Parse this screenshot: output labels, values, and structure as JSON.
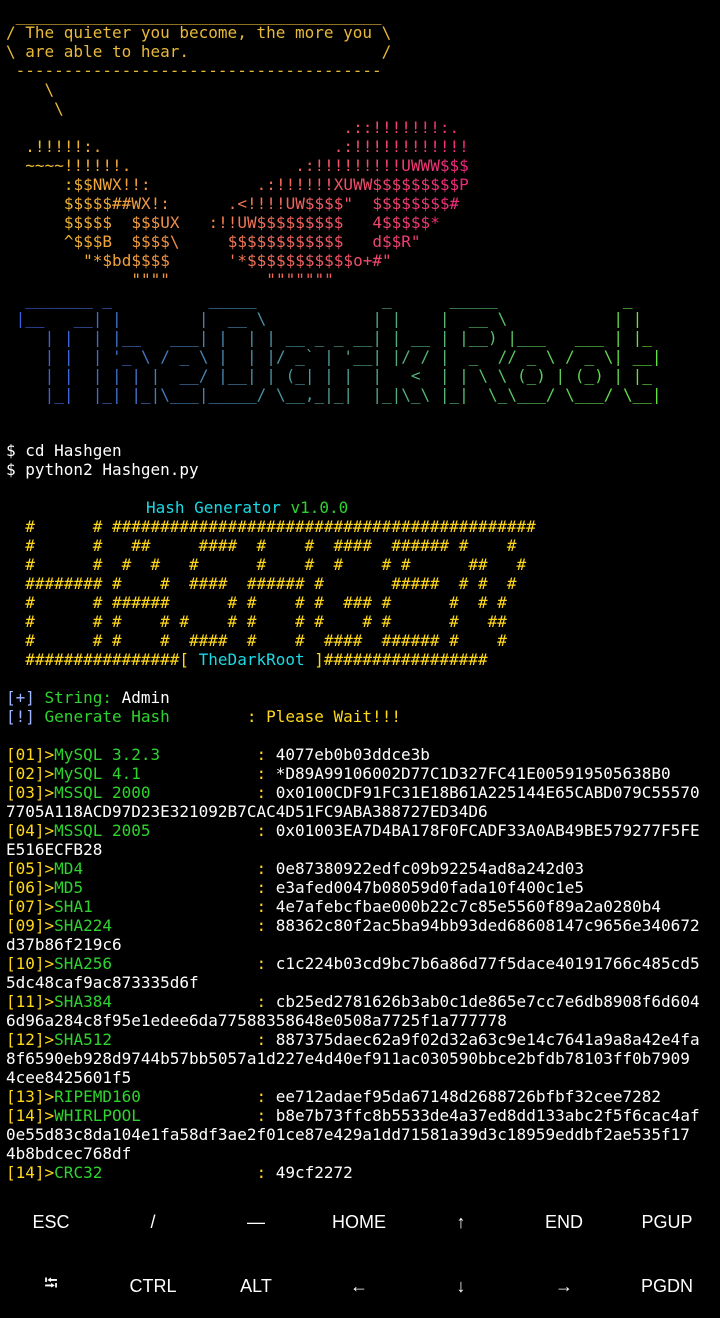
{
  "cowsay": {
    "lines": [
      " ______________________________________",
      "/ The quieter you become, the more you \\",
      "\\ are able to hear.                    /",
      " --------------------------------------",
      "    \\",
      "     \\"
    ]
  },
  "dragon_art": [
    "                                   .::!!!!!!!:.",
    "  .!!!!!:.                        .:!!!!!!!!!!!!",
    "  ~~~~!!!!!!.                 .:!!!!!!!!!UWWW$$$",
    "      :$$NWX!!:           .:!!!!!!XUWW$$$$$$$$$P",
    "      $$$$$##WX!:      .<!!!!UW$$$$\"  $$$$$$$$#",
    "      $$$$$  $$$UX   :!!UW$$$$$$$$$   4$$$$$*",
    "      ^$$$B  $$$$\\     $$$$$$$$$$$$   d$$R\"",
    "        \"*$bd$$$$      '*$$$$$$$$$$$o+#\"",
    "             \"\"\"\"          \"\"\"\"\"\"\""
  ],
  "banner_art": [
    "  _______ _          _____             _      _____             _",
    " |__   __| |        |  __ \\           | |    |  __ \\           | |",
    "    | |  | |__   ___| |  | | __ _ _ __| | __ | |__) |___   ___ | |_",
    "    | |  | '_ \\ / _ \\ |  | |/ _` | '__| |/ / |  _  // _ \\ / _ \\| __|",
    "    | |  | | | |  __/ |__| | (_| | |  |   <  | | \\ \\ (_) | (_) | |_",
    "    |_|  |_| |_|\\___|_____/ \\__,_|_|  |_|\\_\\ |_|  \\_\\___/ \\___/ \\__|"
  ],
  "commands": [
    "$ cd Hashgen",
    "$ python2 Hashgen.py"
  ],
  "hashgen": {
    "title": "Hash Generator",
    "version": "v1.0.0",
    "art": [
      "  #      # ############################################",
      "  #      #   ##     ####  #    #  ####  ###### #    #",
      "  #      #  #  #   #      #    #  #    # #      ##   #",
      "  ######## #    #  ####  ###### #       #####  # #  #",
      "  #      # ######      # #    # #  ### #      #  # #",
      "  #      # #    # #    # #    # #    # #      #   ##",
      "  #      # #    #  ####  #    #  ####  ###### #    #"
    ],
    "footer_left": "  ################[ ",
    "footer_brand": "TheDarkRoot",
    "footer_right": " ]#################"
  },
  "status": {
    "string_tag": "[+]",
    "string_label": " String: ",
    "string_value": "Admin",
    "gen_tag": "[!]",
    "gen_label": " Generate Hash        ",
    "gen_sep": ": ",
    "gen_value": "Please Wait!!!"
  },
  "hashes": [
    {
      "idx": "[01]>",
      "algo": "MySQL 3.2.3",
      "value": "4077eb0b03ddce3b"
    },
    {
      "idx": "[02]>",
      "algo": "MySQL 4.1",
      "value": "*D89A99106002D77C1D327FC41E005919505638B0"
    },
    {
      "idx": "[03]>",
      "algo": "MSSQL 2000",
      "value": "0x0100CDF91FC31E18B61A225144E65CABD079C55570",
      "cont": "7705A118ACD97D23E321092B7CAC4D51FC9ABA388727ED34D6"
    },
    {
      "idx": "[04]>",
      "algo": "MSSQL 2005",
      "value": "0x01003EA7D4BA178F0FCADF33A0AB49BE579277F5FE",
      "cont": "E516ECFB28"
    },
    {
      "idx": "[05]>",
      "algo": "MD4",
      "value": "0e87380922edfc09b92254ad8a242d03"
    },
    {
      "idx": "[06]>",
      "algo": "MD5",
      "value": "e3afed0047b08059d0fada10f400c1e5"
    },
    {
      "idx": "[07]>",
      "algo": "SHA1",
      "value": "4e7afebcfbae000b22c7c85e5560f89a2a0280b4"
    },
    {
      "idx": "[09]>",
      "algo": "SHA224",
      "value": "88362c80f2ac5ba94bb93ded68608147c9656e340672",
      "cont": "d37b86f219c6"
    },
    {
      "idx": "[10]>",
      "algo": "SHA256",
      "value": "c1c224b03cd9bc7b6a86d77f5dace40191766c485cd5",
      "cont": "5dc48caf9ac873335d6f"
    },
    {
      "idx": "[11]>",
      "algo": "SHA384",
      "value": "cb25ed2781626b3ab0c1de865e7cc7e6db8908f6d604",
      "cont": "6d96a284c8f95e1edee6da77588358648e0508a7725f1a777778"
    },
    {
      "idx": "[12]>",
      "algo": "SHA512",
      "value": "887375daec62a9f02d32a63c9e14c7641a9a8a42e4fa",
      "cont": "8f6590eb928d9744b57bb5057a1d227e4d40ef911ac030590bbce2bfdb78103ff0b7909",
      "cont2": "4cee8425601f5"
    },
    {
      "idx": "[13]>",
      "algo": "RIPEMD160",
      "value": "ee712adaef95da67148d2688726bfbf32cee7282"
    },
    {
      "idx": "[14]>",
      "algo": "WHIRLPOOL",
      "value": "b8e7b73ffc8b5533de4a37ed8dd133abc2f5f6cac4af",
      "cont": "0e55d83c8da104e1fa58df3ae2f01ce87e429a1dd71581a39d3c18959eddbf2ae535f17",
      "cont2": "4b8bdcec768df"
    },
    {
      "idx": "[14]>",
      "algo": "CRC32",
      "value": "49cf2272"
    }
  ],
  "extra_keys": {
    "row1": [
      "ESC",
      "/",
      "—",
      "HOME",
      "↑",
      "END",
      "PGUP"
    ],
    "row2": [
      "⭾",
      "CTRL",
      "ALT",
      "←",
      "↓",
      "→",
      "PGDN"
    ]
  },
  "colors": {
    "cow": "#e8b93a",
    "index": "#ffd81a",
    "algo": "#2ed42e",
    "brand": "#1ad9e6"
  }
}
